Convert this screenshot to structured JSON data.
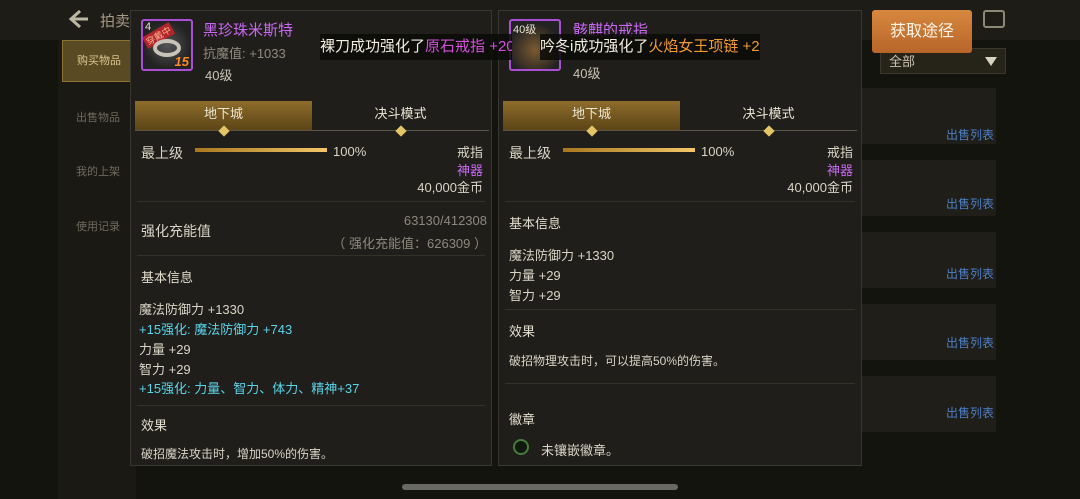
{
  "header": {
    "title_partial": "拍卖",
    "acquire_button": "获取途径",
    "dropdown_value": "全部"
  },
  "sidebar": {
    "items": [
      {
        "label": "购买物品"
      },
      {
        "label": "出售物品"
      },
      {
        "label": "我的上架"
      },
      {
        "label": "使用记录"
      }
    ]
  },
  "background_list": {
    "sell_label": "出售列表"
  },
  "banners": {
    "left": {
      "prefix": "裸刀成功强化了",
      "item": "原石戒指",
      "suffix": " +20"
    },
    "right": {
      "prefix": "吟冬i成功强化了",
      "item": "火焰女王项链",
      "suffix": " +2("
    }
  },
  "left_panel": {
    "icon": {
      "level": "4",
      "tag": "穿戴中",
      "enhance": "15"
    },
    "name": "黑珍珠米斯特",
    "resist": "抗魔值: +1033",
    "level": "40级",
    "tabs": [
      "地下城",
      "决斗模式"
    ],
    "grade": {
      "label": "最上级",
      "percent": "100%"
    },
    "type": "戒指",
    "rarity": "神器",
    "price": "40,000金币",
    "charge": {
      "label": "强化充能值",
      "value": "63130/412308",
      "detail": "（ 强化充能值：626309 ）"
    },
    "basic_title": "基本信息",
    "stats": [
      {
        "text": "魔法防御力 +1330",
        "style": "normal"
      },
      {
        "text": "+15强化:  魔法防御力 +743",
        "style": "cyan"
      },
      {
        "text": "力量 +29",
        "style": "normal"
      },
      {
        "text": "智力 +29",
        "style": "normal"
      },
      {
        "text": "+15强化:  力量、智力、体力、精神+37",
        "style": "cyan"
      }
    ],
    "effect_title": "效果",
    "effect_text": "破招魔法攻击时，增加50%的伤害。"
  },
  "right_panel": {
    "icon": {
      "level": "40级"
    },
    "name": "骸麒的戒指",
    "level": "40级",
    "tabs": [
      "地下城",
      "决斗模式"
    ],
    "grade": {
      "label": "最上级",
      "percent": "100%"
    },
    "type": "戒指",
    "rarity": "神器",
    "price": "40,000金币",
    "basic_title": "基本信息",
    "stats": [
      "魔法防御力 +1330",
      "力量 +29",
      "智力 +29"
    ],
    "effect_title": "效果",
    "effect_text": "破招物理攻击时，可以提高50%的伤害。",
    "emblem_title": "徽章",
    "emblem_text": "未镶嵌徽章。"
  },
  "colors": {
    "accent": "#c968f2",
    "enhance": "#5ad4ea",
    "button": "#c8763a"
  }
}
